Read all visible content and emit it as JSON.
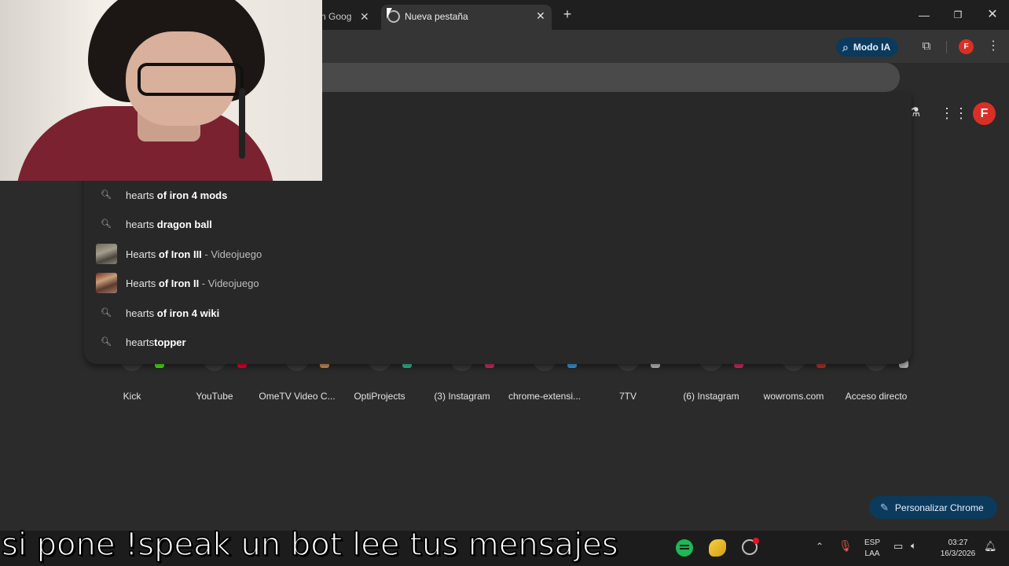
{
  "browser": {
    "tabs": [
      {
        "title": "n Googl",
        "active": false
      },
      {
        "title": "Nueva pestaña",
        "active": true
      }
    ],
    "toolbar": {
      "modo_ia_label": "Modo IA",
      "profile_initial": "F"
    }
  },
  "page": {
    "profile_initial": "F",
    "suggestions": [
      {
        "prefix": "hearts ",
        "bold": "of iron 4 mods",
        "sub": "",
        "icon": "search-icon"
      },
      {
        "prefix": "hearts ",
        "bold": "dragon ball",
        "sub": "",
        "icon": "search-icon"
      },
      {
        "prefix": "Hearts ",
        "bold": "of Iron III",
        "sub": " - Videojuego",
        "icon": "game-thumbnail"
      },
      {
        "prefix": "Hearts ",
        "bold": "of Iron II",
        "sub": " - Videojuego",
        "icon": "game-thumbnail"
      },
      {
        "prefix": "hearts ",
        "bold": "of iron 4 wiki",
        "sub": "",
        "icon": "search-icon"
      },
      {
        "prefix": "hearts",
        "bold": "topper",
        "sub": "",
        "icon": "search-icon"
      }
    ],
    "shortcuts": [
      {
        "label": "Kick",
        "color": "#53fc18"
      },
      {
        "label": "YouTube",
        "color": "#ff0033"
      },
      {
        "label": "OmeTV Video C...",
        "color": "#e0a060"
      },
      {
        "label": "OptiProjects",
        "color": "#3cc8a0"
      },
      {
        "label": "(3) Instagram",
        "color": "#e1306c"
      },
      {
        "label": "chrome-extensi...",
        "color": "#3fa9f5"
      },
      {
        "label": "7TV",
        "color": "#cfcfcf"
      },
      {
        "label": "(6) Instagram",
        "color": "#e1306c"
      },
      {
        "label": "wowroms.com",
        "color": "#c0392b"
      },
      {
        "label": "Acceso directo",
        "color": "#bdbdbd"
      }
    ],
    "customize_label": "Personalizar Chrome"
  },
  "taskbar": {
    "lang_top": "ESP",
    "lang_bottom": "LAA",
    "time": "03:27",
    "date": "16/3/2026"
  },
  "subtitle": "si pone !speak un bot lee tus mensajes"
}
